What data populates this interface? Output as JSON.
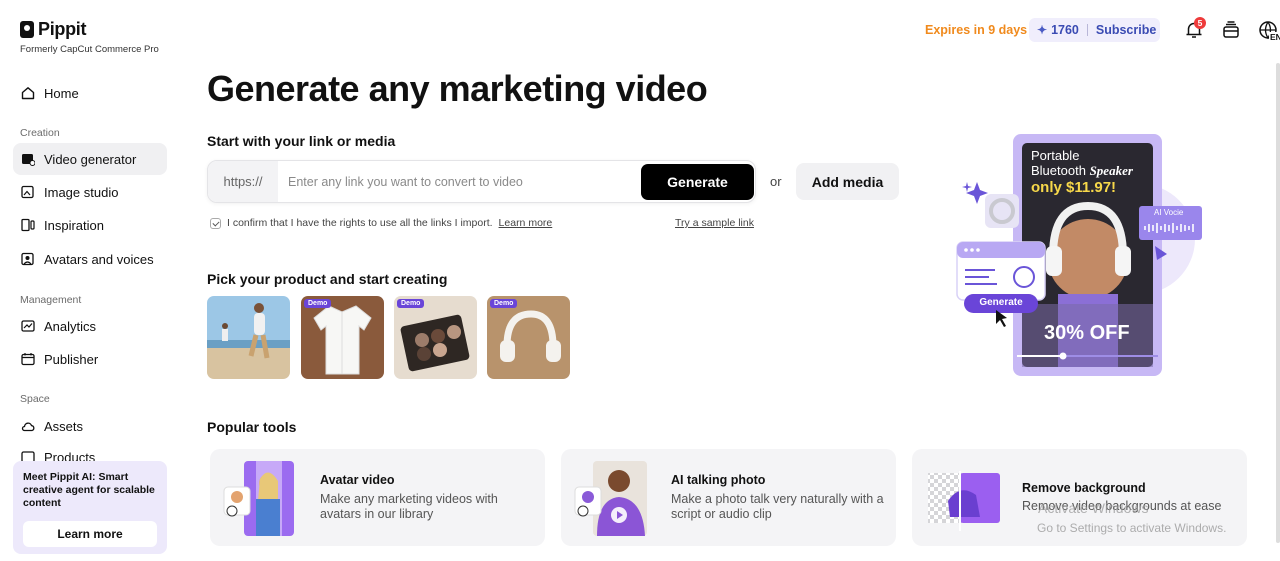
{
  "brand": {
    "name": "Pippit",
    "sub": "Formerly CapCut Commerce Pro"
  },
  "sidebar": {
    "home": "Home",
    "creation_label": "Creation",
    "creation": [
      "Video generator",
      "Image studio",
      "Inspiration",
      "Avatars and voices"
    ],
    "management_label": "Management",
    "management": [
      "Analytics",
      "Publisher"
    ],
    "space_label": "Space",
    "space": [
      "Assets",
      "Products"
    ],
    "promo_text": "Meet Pippit AI: Smart creative agent for scalable content",
    "promo_button": "Learn more"
  },
  "topbar": {
    "expires": "Expires in 9 days",
    "credits": "1760",
    "subscribe": "Subscribe",
    "notifications": "5",
    "language": "EN"
  },
  "main": {
    "title": "Generate any marketing video",
    "link_section": "Start with your link or media",
    "link_prefix": "https://",
    "link_placeholder": "Enter any link you want to convert to video",
    "generate": "Generate",
    "or": "or",
    "add_media": "Add media",
    "confirm_text": "I confirm that I have the rights to use all the links I import.",
    "learn_more": "Learn more",
    "sample_link": "Try a sample link",
    "pick_title": "Pick your product and start creating",
    "demo_badge": "Demo",
    "popular_title": "Popular tools"
  },
  "hero": {
    "headline_1": "Portable",
    "headline_2": "Bluetooth",
    "headline_3": "Speaker",
    "price": "only $11.97!",
    "discount": "30% OFF",
    "ai_voice": "AI Vocie",
    "generate": "Generate"
  },
  "tools": [
    {
      "title": "Avatar video",
      "desc": "Make any marketing videos with avatars in our library"
    },
    {
      "title": "AI talking photo",
      "desc": "Make a photo talk very naturally with a script or audio clip"
    },
    {
      "title": "Remove background",
      "desc": "Remove video backgrounds at ease"
    }
  ],
  "watermark": {
    "line1": "Activate Windows",
    "line2": "Go to Settings to activate Windows."
  },
  "colors": {
    "accent": "#6a45d8",
    "orange": "#f08a1d",
    "subscribe": "#3a4bb3"
  }
}
